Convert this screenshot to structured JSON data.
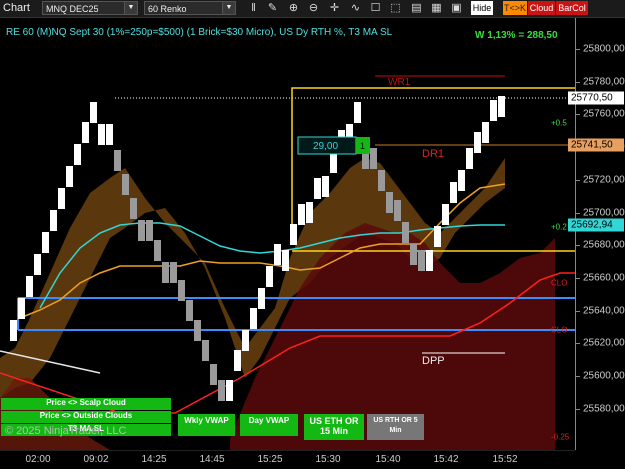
{
  "toolbar": {
    "title": "Chart",
    "instrument": "MNQ DEC25",
    "bar_type": "60 Renko",
    "hide_label": "Hide",
    "tk_label": "T<>K",
    "cloud_label": "Cloud",
    "barcol_label": "BarCol"
  },
  "header": {
    "description": "RE 60 (M)NQ Sept 30 (1%=250p=$500) (1 Brick=$30 Micro), US Dy RTH %, T3 MA SL",
    "win_text": "W 1,13% = 288,50"
  },
  "labels": {
    "wr1": "WR1",
    "dr1": "DR1",
    "dpp": "DPP",
    "box_value": "29,00",
    "box_count": "1",
    "watermark": "© 2025 NinjaTrader, LLC"
  },
  "levels": {
    "plus05": "+0.5",
    "plus025": "+0.2",
    "clo1": "CLO",
    "clo2": "CLO",
    "minus025": "-0.25"
  },
  "buttons": {
    "scalp_cloud": "Price <> Scalp Cloud",
    "outside_clouds": "Price <> Outside Clouds",
    "t3_ma_sl": "T3 MA SL",
    "wkly_vwap": "Wkly VWAP",
    "day_vwap": "Day VWAP",
    "us_eth_or": "US ETH OR 15 Min",
    "us_rth_or": "US RTH OR 5 Min"
  },
  "price_tags": {
    "last": "25770,50",
    "dr1": "25741,50",
    "cyan": "25692,94"
  },
  "y_axis": [
    "25800,00",
    "25780,00",
    "25760,00",
    "25740,00",
    "25720,00",
    "25700,00",
    "25680,00",
    "25660,00",
    "25640,00",
    "25620,00",
    "25600,00",
    "25580,00"
  ],
  "x_axis": [
    "02:00",
    "09:02",
    "14:25",
    "14:45",
    "15:25",
    "15:30",
    "15:40",
    "15:42",
    "15:52"
  ],
  "colors": {
    "up_brick": "#ffffff",
    "down_brick": "#9a9a9a",
    "cyan_line": "#33d6d6",
    "orange_line": "#f0a020",
    "yellow_line": "#ffd21a",
    "blue_line": "#3a8cff",
    "red_line": "#ff2020",
    "green_button": "#13b813"
  }
}
